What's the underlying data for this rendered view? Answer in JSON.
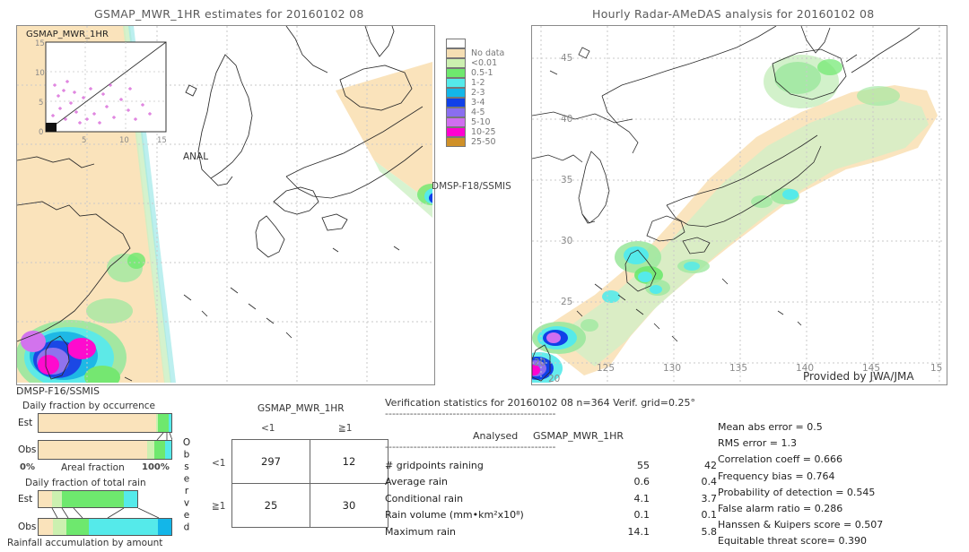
{
  "left_panel": {
    "title": "GSMAP_MWR_1HR estimates for 20160102 08",
    "inset": {
      "label": "GSMAP_MWR_1HR",
      "xlabel": "ANAL",
      "yticks": [
        "15",
        "10",
        "5",
        "0"
      ],
      "xticks": [
        "5",
        "10",
        "15"
      ]
    },
    "swath_labels": [
      "DMSP-F18/SSMIS",
      "DMSP-F16/SSMIS"
    ],
    "colorbar": {
      "entries": [
        {
          "label": "",
          "color": "#ffffff"
        },
        {
          "label": "No data",
          "color": "#f5deb3"
        },
        {
          "label": "<0.01",
          "color": "#ccf0b0"
        },
        {
          "label": "0.5-1",
          "color": "#6ee86e"
        },
        {
          "label": "1-2",
          "color": "#55eaea"
        },
        {
          "label": "2-3",
          "color": "#13b6e8"
        },
        {
          "label": "3-4",
          "color": "#1040e8"
        },
        {
          "label": "4-5",
          "color": "#8a6ef0"
        },
        {
          "label": "5-10",
          "color": "#d06ef0"
        },
        {
          "label": "10-25",
          "color": "#ff00d0"
        },
        {
          "label": "25-50",
          "color": "#cf9028"
        }
      ]
    }
  },
  "right_panel": {
    "title": "Hourly Radar-AMeDAS analysis for 20160102 08",
    "credit": "Provided by JWA/JMA",
    "lon_ticks": [
      "20",
      "125",
      "130",
      "135",
      "140",
      "145",
      "15"
    ],
    "lat_ticks": [
      "45",
      "40",
      "35",
      "30",
      "25",
      "20"
    ],
    "corner_label": "20"
  },
  "fraction_charts": [
    {
      "title": "Daily fraction by occurrence",
      "axis_left": "0%",
      "axis_center": "Areal fraction",
      "axis_right": "100%",
      "rows": [
        {
          "label": "Est",
          "segments": [
            {
              "color": "#fae3bb",
              "pct": 88.5
            },
            {
              "color": "#ccf0b0",
              "pct": 1.5
            },
            {
              "color": "#6ee86e",
              "pct": 8.0
            },
            {
              "color": "#55eaea",
              "pct": 2.0
            }
          ]
        },
        {
          "label": "Obs",
          "segments": [
            {
              "color": "#fae3bb",
              "pct": 82.0
            },
            {
              "color": "#ccf0b0",
              "pct": 5.0
            },
            {
              "color": "#6ee86e",
              "pct": 8.5
            },
            {
              "color": "#55eaea",
              "pct": 4.5
            }
          ]
        }
      ]
    },
    {
      "title": "Daily fraction of total rain",
      "caption": "Rainfall accumulation by amount",
      "rows": [
        {
          "label": "Est",
          "width_pct": 75,
          "segments": [
            {
              "color": "#fae3bb",
              "pct": 14
            },
            {
              "color": "#ccf0b0",
              "pct": 10
            },
            {
              "color": "#6ee86e",
              "pct": 62
            },
            {
              "color": "#55eaea",
              "pct": 14
            }
          ]
        },
        {
          "label": "Obs",
          "width_pct": 100,
          "segments": [
            {
              "color": "#fae3bb",
              "pct": 11
            },
            {
              "color": "#ccf0b0",
              "pct": 10
            },
            {
              "color": "#6ee86e",
              "pct": 17
            },
            {
              "color": "#55eaea",
              "pct": 52
            },
            {
              "color": "#13b6e8",
              "pct": 10
            }
          ]
        }
      ]
    }
  ],
  "contingency": {
    "title": "GSMAP_MWR_1HR",
    "col_headers": [
      "<1",
      "≧1"
    ],
    "row_headers": [
      "<1",
      "≧1"
    ],
    "observed_label": "Observed",
    "cells": [
      [
        "297",
        "12"
      ],
      [
        "25",
        "30"
      ]
    ]
  },
  "verification": {
    "header": "Verification statistics for 20160102 08   n=364  Verif. grid=0.25°",
    "rule": "------------------------------------------------",
    "col_headers": [
      "Analysed",
      "GSMAP_MWR_1HR"
    ],
    "rows": [
      {
        "name": "# gridpoints raining",
        "analysed": "55",
        "estimate": "42"
      },
      {
        "name": "Average rain",
        "analysed": "0.6",
        "estimate": "0.4"
      },
      {
        "name": "Conditional rain",
        "analysed": "4.1",
        "estimate": "3.7"
      },
      {
        "name": "Rain volume (mm•km²x10⁸)",
        "analysed": "0.1",
        "estimate": "0.1"
      },
      {
        "name": "Maximum rain",
        "analysed": "14.1",
        "estimate": "5.8"
      }
    ]
  },
  "scores": [
    "Mean abs error = 0.5",
    "RMS error = 1.3",
    "Correlation coeff = 0.666",
    "Frequency bias = 0.764",
    "Probability of detection = 0.545",
    "False alarm ratio = 0.286",
    "Hanssen & Kuipers score = 0.507",
    "Equitable threat score= 0.390"
  ]
}
